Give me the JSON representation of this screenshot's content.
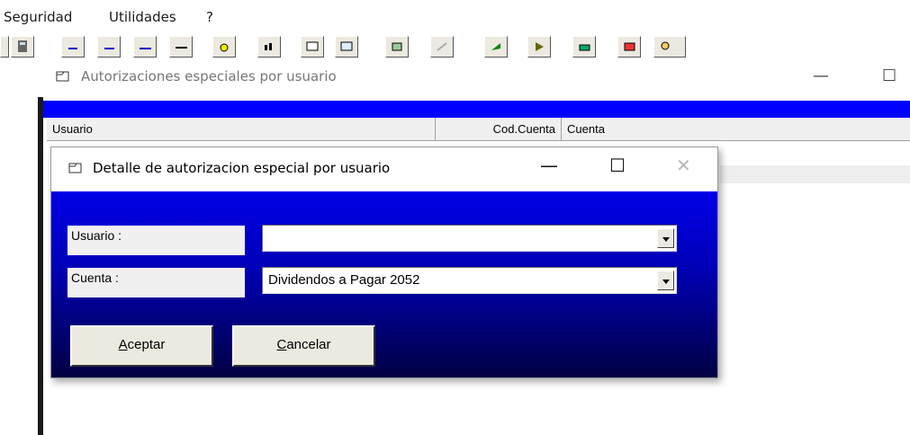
{
  "menu": {
    "items": [
      "Seguridad",
      "Utilidades",
      "?"
    ]
  },
  "mdi_window": {
    "title": "Autorizaciones especiales por usuario",
    "minimize": "—",
    "maximize": "☐"
  },
  "grid": {
    "columns": [
      "Usuario",
      "Cod.Cuenta",
      "Cuenta"
    ]
  },
  "dialog": {
    "title": "Detalle de autorizacion especial por usuario",
    "minimize": "—",
    "maximize": "☐",
    "close": "✕",
    "fields": {
      "usuario": {
        "label": "Usuario :",
        "value": ""
      },
      "cuenta": {
        "label": "Cuenta :",
        "value": "Dividendos a Pagar 2052"
      }
    },
    "buttons": {
      "accept_prefix": "A",
      "accept_rest": "ceptar",
      "cancel_prefix": "C",
      "cancel_rest": "ancelar"
    }
  },
  "colors": {
    "dialog_gradient_top": "#0000e8",
    "dialog_gradient_bottom": "#000040",
    "strip": "#0000ff"
  }
}
